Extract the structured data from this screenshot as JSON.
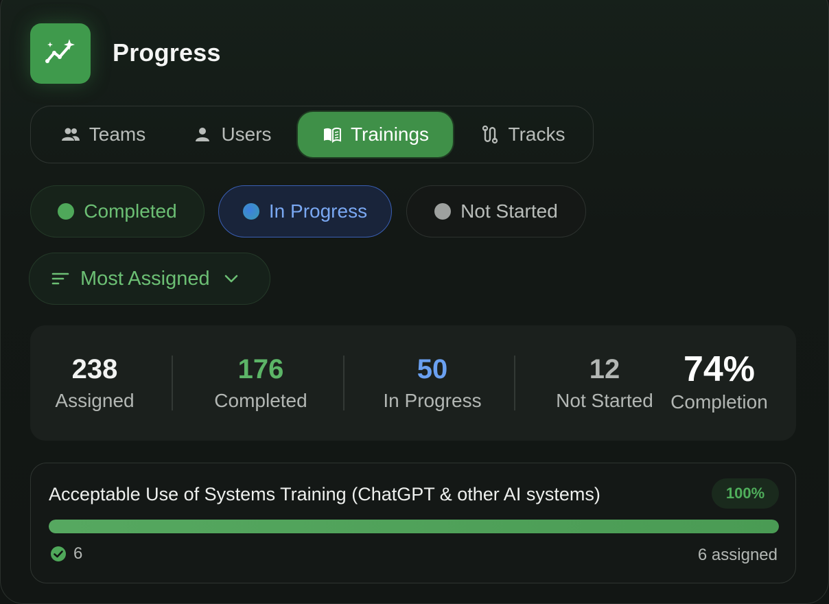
{
  "header": {
    "title": "Progress",
    "icon": "sparkle-chart-icon",
    "accent": "#3f9a4c"
  },
  "tabs": [
    {
      "label": "Teams",
      "icon": "people-icon",
      "active": false
    },
    {
      "label": "Users",
      "icon": "person-icon",
      "active": false
    },
    {
      "label": "Trainings",
      "icon": "book-icon",
      "active": true
    },
    {
      "label": "Tracks",
      "icon": "route-icon",
      "active": false
    }
  ],
  "filters": [
    {
      "label": "Completed",
      "color": "#4fa85a"
    },
    {
      "label": "In Progress",
      "color": "#3d7fe0",
      "selected": true
    },
    {
      "label": "Not Started",
      "color": "#9ea19f"
    }
  ],
  "sort": {
    "label": "Most Assigned",
    "icon": "sort-icon"
  },
  "stats": {
    "assigned": {
      "value": "238",
      "label": "Assigned"
    },
    "completed": {
      "value": "176",
      "label": "Completed"
    },
    "in_progress": {
      "value": "50",
      "label": "In Progress"
    },
    "not_started": {
      "value": "12",
      "label": "Not Started"
    },
    "completion": {
      "value": "74%",
      "label": "Completion"
    }
  },
  "trainings": [
    {
      "title": "Acceptable Use of Systems Training (ChatGPT & other AI systems)",
      "percent_label": "100%",
      "progress": 1.0,
      "completed_count": "6",
      "assigned_label": "6 assigned"
    }
  ]
}
